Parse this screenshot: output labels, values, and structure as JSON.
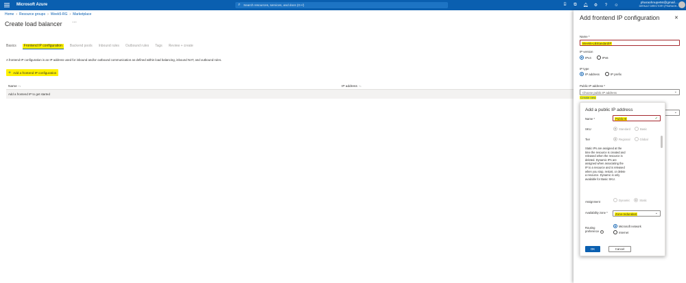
{
  "topbar": {
    "brand": "Microsoft Azure",
    "search_placeholder": "Search resources, services, and docs (G+/)",
    "user_email": "pharaohnupe94@gmail....",
    "user_directory": "DEFAULT DIRECTORY (PHARAOH..."
  },
  "breadcrumb": [
    "Home",
    "Resource groups",
    "Week5-RG",
    "Marketplace"
  ],
  "page": {
    "title": "Create load balancer",
    "more": "···"
  },
  "tabs": [
    {
      "label": "Basics",
      "state": "normal"
    },
    {
      "label": "Frontend IP configuration",
      "state": "active"
    },
    {
      "label": "Backend pools",
      "state": "dim"
    },
    {
      "label": "Inbound rules",
      "state": "dim"
    },
    {
      "label": "Outbound rules",
      "state": "dim"
    },
    {
      "label": "Tags",
      "state": "dim"
    },
    {
      "label": "Review + create",
      "state": "dim"
    }
  ],
  "description": "A frontend IP configuration is an IP address used for inbound and/or outbound communication as defined within load balancing, inbound NAT, and outbound rules.",
  "add_button": "Add a frontend IP configuration",
  "grid": {
    "headers": [
      "Name ↑↓",
      "IP address ↑↓"
    ],
    "col_name": "Name",
    "col_ip": "IP address",
    "empty_row": "Add a frontend IP to get started"
  },
  "panel": {
    "title": "Add frontend IP configuration",
    "close": "✕",
    "name_label": "Name *",
    "name_value": "Week5-LBStandardIP",
    "ip_version_label": "IP version",
    "ip_version_options": [
      "IPv4",
      "IPv6"
    ],
    "ip_type_label": "IP type",
    "ip_type_options": [
      "IP address",
      "IP prefix"
    ],
    "public_ip_label": "Public IP address *",
    "public_ip_placeholder": "Choose public IP address",
    "create_new": "Create new"
  },
  "dialog": {
    "title": "Add a public IP address",
    "name_label": "Name *",
    "name_value": "Public-B",
    "sku_label": "SKU",
    "sku_options": [
      "Standard",
      "Basic"
    ],
    "tier_label": "Tier",
    "tier_options": [
      "Regional",
      "Global"
    ],
    "info_text": "Static IPs are assigned at the time the resource is created and released when the resource is deleted. Dynamic IPs are assigned when associating the IP to a resource and is released when you stop, restart, or delete a resource. Dynamic is only available for Basic SKU.",
    "assignment_label": "Assignment",
    "assignment_options": [
      "Dynamic",
      "Static"
    ],
    "az_label": "Availability zone *",
    "az_value": "Zone-redundant",
    "routing_label": "Routing preference",
    "routing_options": [
      "Microsoft network",
      "Internet"
    ],
    "ok": "OK",
    "cancel": "Cancel"
  },
  "colors": {
    "azure_blue": "#0a5fb0",
    "highlight": "#fff100"
  }
}
